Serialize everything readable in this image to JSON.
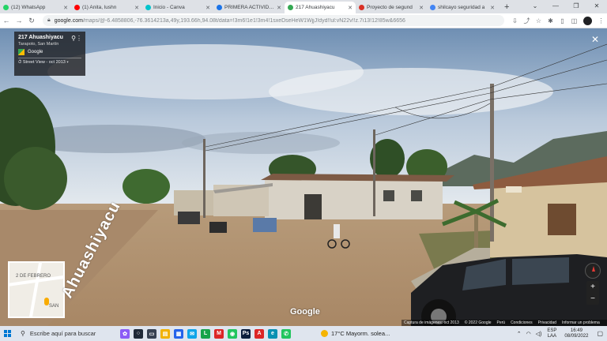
{
  "browser": {
    "tabs": [
      {
        "label": "(12) WhatsApp",
        "color": "#25d366",
        "active": false
      },
      {
        "label": "(1) Anita, lushn",
        "color": "#ff0000",
        "active": false
      },
      {
        "label": "Inicio - Canva",
        "color": "#00c4cc",
        "active": false
      },
      {
        "label": "PRIMERA ACTIVIDAD",
        "color": "#1a73e8",
        "active": false
      },
      {
        "label": "217 Ahuashiyacu",
        "color": "#34a853",
        "active": true
      },
      {
        "label": "Proyecto de segund",
        "color": "#d93025",
        "active": false
      },
      {
        "label": "shilcayo seguridad a",
        "color": "#4285f4",
        "active": false
      }
    ],
    "new_tab": "+",
    "window_controls": [
      "⌄",
      "—",
      "❐",
      "✕"
    ],
    "url_host": "google.com",
    "url_path": "/maps/@-6.4858806,-76.3614213a,49y,193.66h,94.08t/data=!3m6!1e1!3m4!1sxeDseHeW1WjjJ!dyd!!ul:vN22v!!z.7i13!12!85w&6656"
  },
  "streetview": {
    "place_title": "217 Ahuashiyacu",
    "place_subtitle": "Tarapoto, San Martín",
    "provider": "Google",
    "imagery_label": "Street View - oct 2013",
    "road_label": "Ahuashiyacu",
    "watermark": "Google",
    "minimap_labels": [
      "2 DE FEBRERO",
      "SAN"
    ],
    "credits": [
      "Captura de imágenes: oct 2013",
      "© 2022 Google",
      "Perú",
      "Condiciones",
      "Privacidad",
      "Informar un problema"
    ]
  },
  "taskbar": {
    "search_placeholder": "Escribe aquí para buscar",
    "weather_text": "17°C  Mayorm. solea...",
    "lang_top": "ESP",
    "lang_bottom": "LAA",
    "time": "16:49",
    "date": "08/09/2022",
    "apps": [
      {
        "name": "chat-app-icon",
        "color": "#8b5cf6",
        "glyph": "✿"
      },
      {
        "name": "cortana-icon",
        "color": "#1f2937",
        "glyph": "○"
      },
      {
        "name": "task-view-icon",
        "color": "#374151",
        "glyph": "▭"
      },
      {
        "name": "file-explorer-icon",
        "color": "#f2b200",
        "glyph": "▤"
      },
      {
        "name": "store-icon",
        "color": "#2563eb",
        "glyph": "▦"
      },
      {
        "name": "mail-icon",
        "color": "#0ea5e9",
        "glyph": "✉"
      },
      {
        "name": "libreoffice-icon",
        "color": "#16a34a",
        "glyph": "L"
      },
      {
        "name": "mcafee-icon",
        "color": "#dc2626",
        "glyph": "M"
      },
      {
        "name": "chrome-icon",
        "color": "#22c55e",
        "glyph": "◉"
      },
      {
        "name": "photoshop-icon",
        "color": "#0c1e3c",
        "glyph": "Ps"
      },
      {
        "name": "acrobat-icon",
        "color": "#dc2626",
        "glyph": "A"
      },
      {
        "name": "edge-icon",
        "color": "#0891b2",
        "glyph": "e"
      },
      {
        "name": "whatsapp-icon",
        "color": "#22c55e",
        "glyph": "✆"
      }
    ]
  }
}
